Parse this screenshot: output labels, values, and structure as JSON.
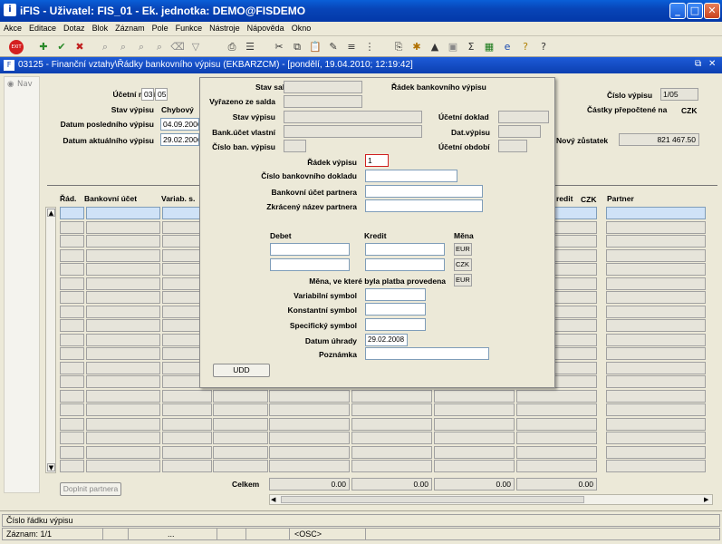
{
  "window": {
    "title": "iFIS - Uživatel: FIS_01 - Ek. jednotka: DEMO@FISDEMO"
  },
  "menu": [
    "Akce",
    "Editace",
    "Dotaz",
    "Blok",
    "Záznam",
    "Pole",
    "Funkce",
    "Nástroje",
    "Nápověda",
    "Okno"
  ],
  "child_window": {
    "title": "03125 - Finanční vztahy\\Řádky bankovního výpisu (EKBARZCM) - [pondělí, 19.04.2010; 12:19:42]"
  },
  "nav": {
    "label": "Nav"
  },
  "header": {
    "ucetni_mesic_label": "Účetní měsíc",
    "mesic": "03",
    "rok": "05",
    "stav_vypisu_label": "Stav výpisu",
    "stav_vypisu_value": "Chybový",
    "datum_posledniho_label": "Datum posledního výpisu",
    "datum_posledniho_value": "04.09.2006",
    "datum_aktualniho_label": "Datum aktuálního výpisu",
    "datum_aktualniho_value": "29.02.2006",
    "cislo_vypisu_label": "Číslo výpisu",
    "cislo_vypisu_value": "1/05",
    "castky_label": "Částky přepočtené na",
    "castky_mena": "CZK",
    "novy_zustatek_label": "Nový zůstatek",
    "novy_zustatek_value": "821 467.50"
  },
  "grid": {
    "col_rad": "Řád.",
    "col_bankovni_ucet": "Bankovní účet",
    "col_variab": "Variab. s.",
    "col_kredit": "redit",
    "col_czk": "CZK",
    "col_partner": "Partner",
    "celkem_label": "Celkem",
    "totals": [
      "0.00",
      "0.00",
      "0.00",
      "0.00"
    ],
    "doplnit_partnera": "Doplnit partnera"
  },
  "dialog": {
    "stav_salda_label": "Stav salda",
    "vyrazeno_label": "Vyřazeno ze salda",
    "stav_vypisu_label": "Stav výpisu",
    "bank_ucet_vlastni_label": "Bank.účet vlastní",
    "cislo_ban_vypisu_label": "Číslo ban. výpisu",
    "radek_bankovniho_label": "Řádek bankovního výpisu",
    "ucetni_doklad_label": "Účetní doklad",
    "dat_vypisu_label": "Dat.výpisu",
    "ucetni_obdobi_label": "Účetní období",
    "radek_vypisu_label": "Řádek výpisu",
    "radek_vypisu_value": "1",
    "cislo_bank_dokladu_label": "Číslo bankovního dokladu",
    "bank_ucet_partnera_label": "Bankovní účet partnera",
    "zkraceny_nazev_label": "Zkrácený název partnera",
    "debet_label": "Debet",
    "kredit_label": "Kredit",
    "mena_label": "Měna",
    "mena_eur": "EUR",
    "mena_czk": "CZK",
    "mena_platby_label": "Měna, ve které byla platba provedena",
    "mena_platby_value": "EUR",
    "variabilni_label": "Variabilní symbol",
    "konstantni_label": "Konstantní symbol",
    "specificky_label": "Specifický symbol",
    "datum_uhrady_label": "Datum úhrady",
    "datum_uhrady_value": "29.02.2008",
    "poznamka_label": "Poznámka",
    "udd_button": "UDD"
  },
  "status": {
    "line1": "Číslo řádku výpisu",
    "zaznam": "Záznam: 1/1",
    "dots": "...",
    "osc": "<OSC>"
  }
}
